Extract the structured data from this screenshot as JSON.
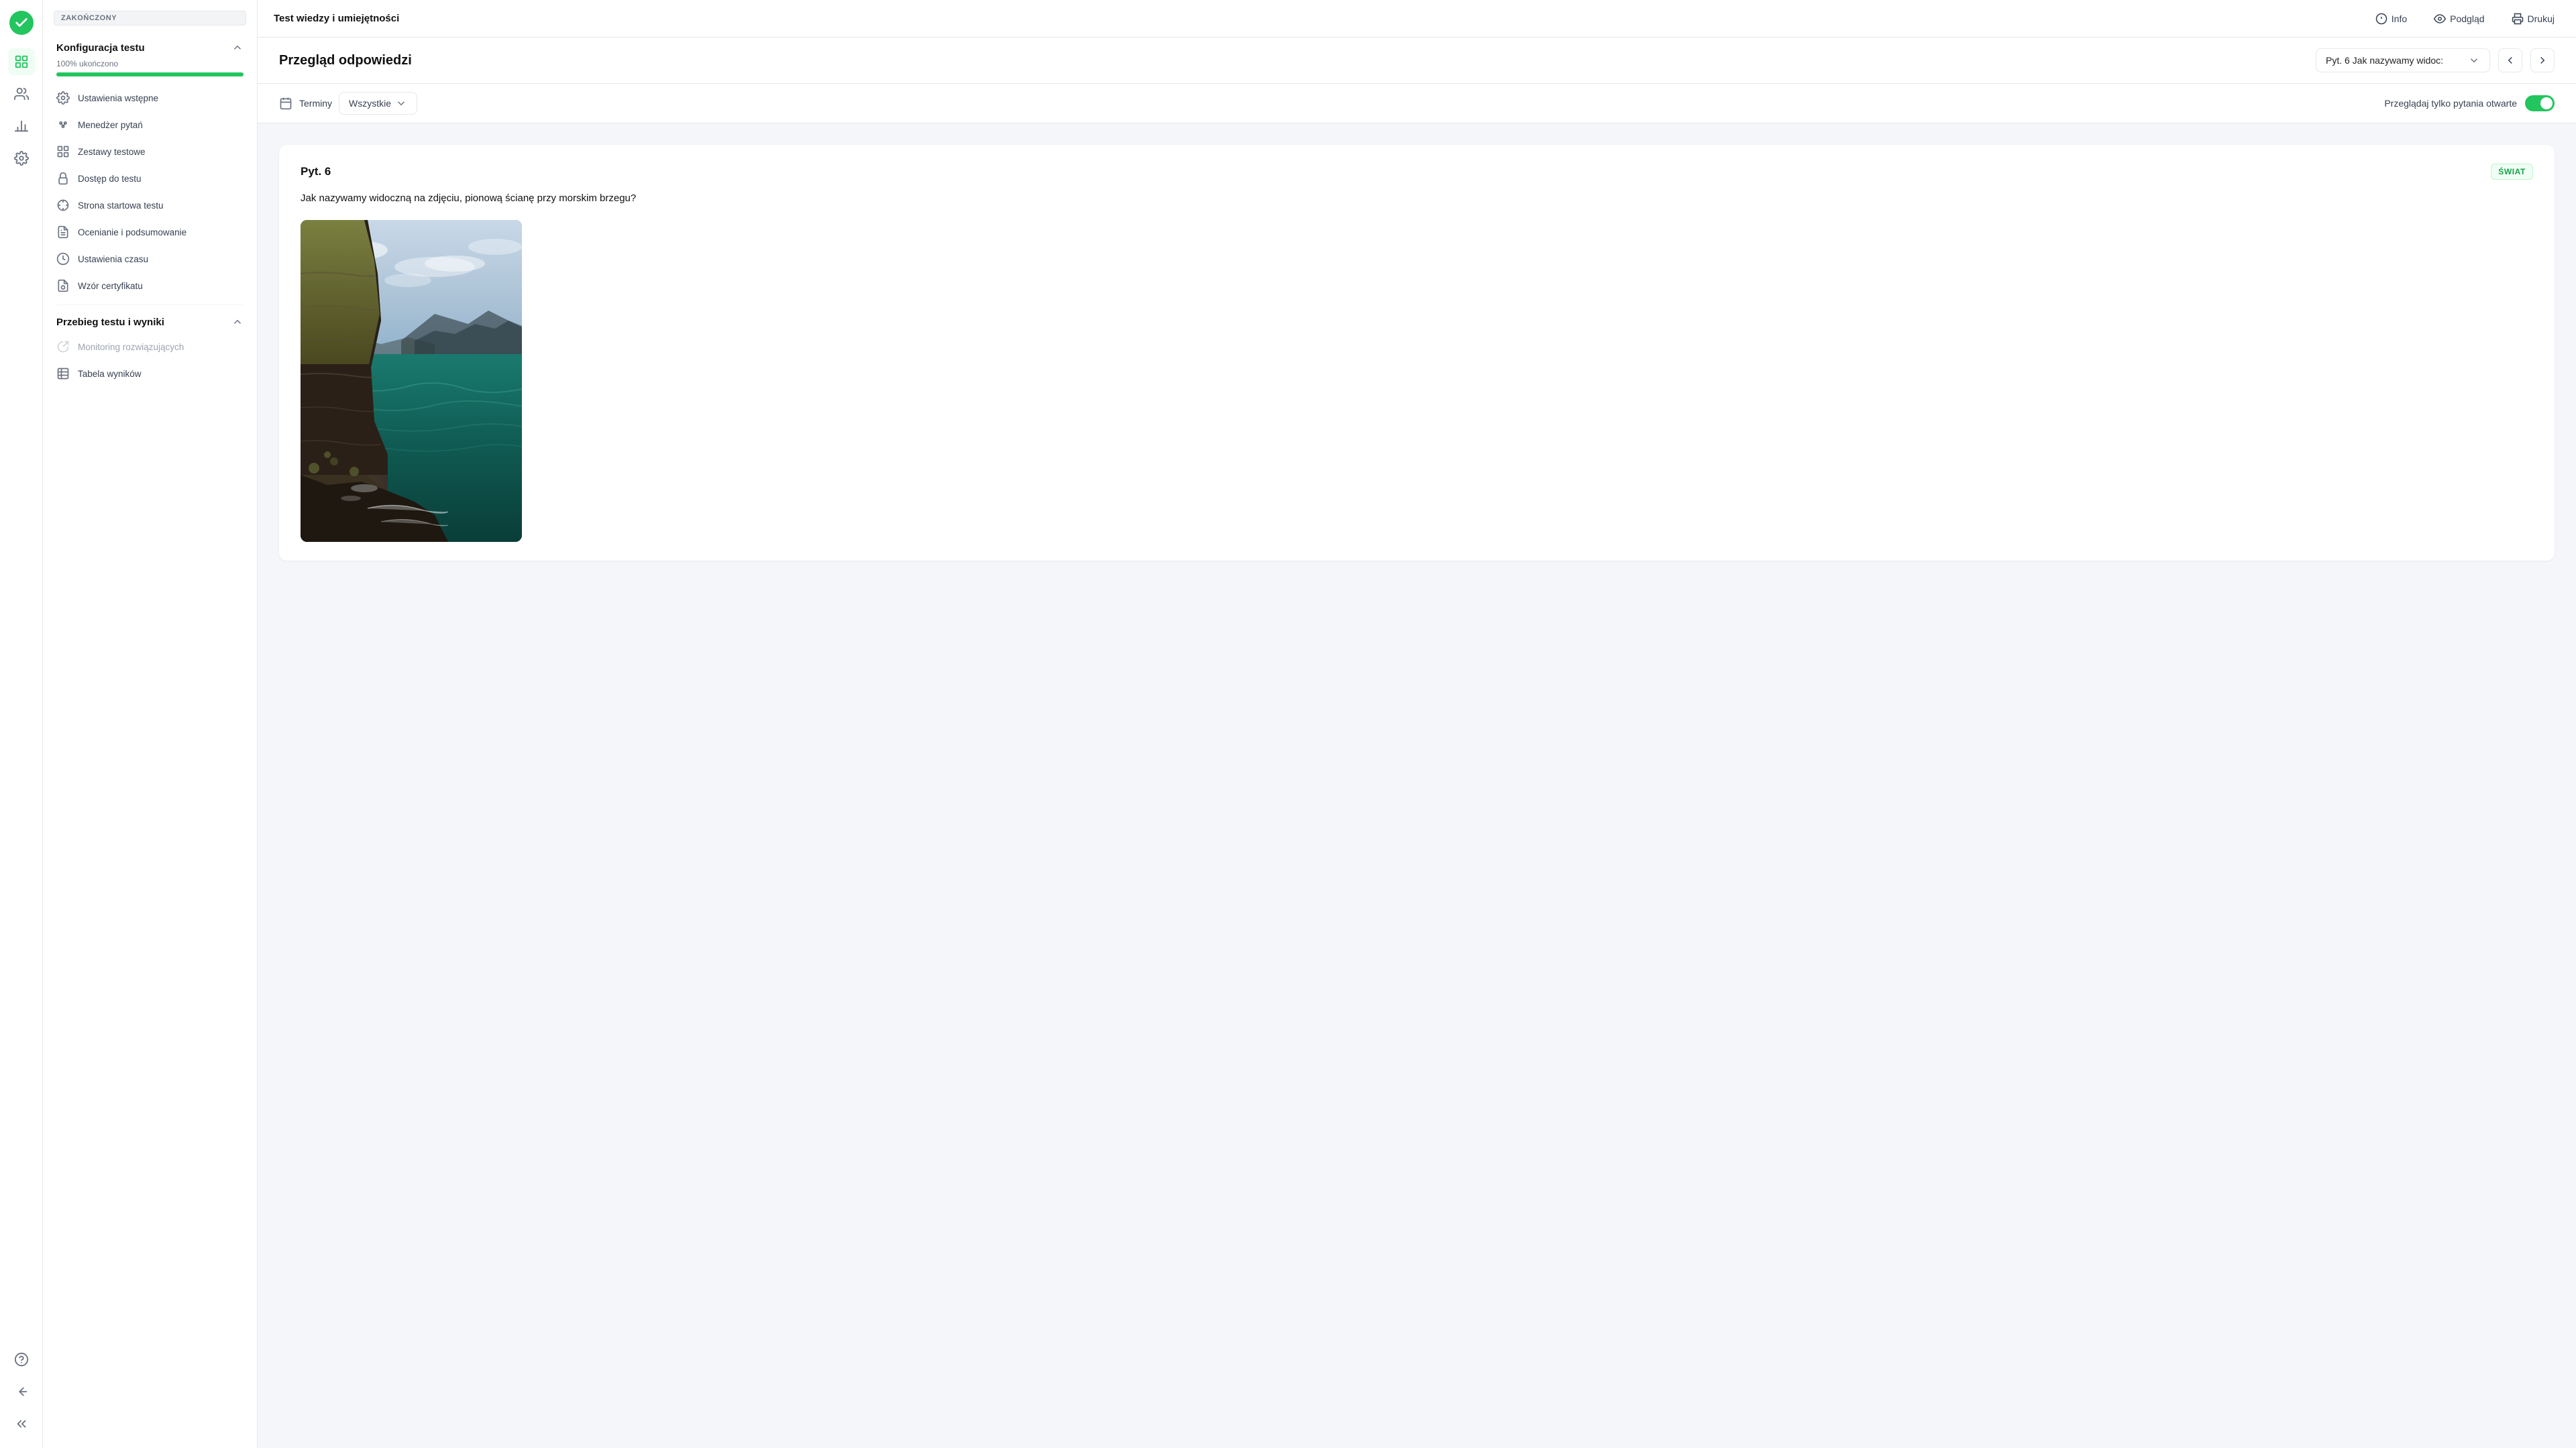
{
  "app": {
    "title": "Test wiedzy i umiejętności"
  },
  "topbar": {
    "info_label": "Info",
    "preview_label": "Podgląd",
    "print_label": "Drukuj"
  },
  "sidebar": {
    "status_badge": "ZAKOŃCZONY",
    "config_section_title": "Konfiguracja testu",
    "progress_label": "100% ukończono",
    "progress_value": 100,
    "config_items": [
      {
        "label": "Ustawienia wstępne",
        "icon": "settings-icon"
      },
      {
        "label": "Menedżer pytań",
        "icon": "questions-icon"
      },
      {
        "label": "Zestawy testowe",
        "icon": "sets-icon"
      },
      {
        "label": "Dostęp do testu",
        "icon": "lock-icon"
      },
      {
        "label": "Strona startowa testu",
        "icon": "start-page-icon"
      },
      {
        "label": "Ocenianie i podsumowanie",
        "icon": "grading-icon"
      },
      {
        "label": "Ustawienia czasu",
        "icon": "time-icon"
      },
      {
        "label": "Wzór certyfikatu",
        "icon": "certificate-icon"
      }
    ],
    "results_section_title": "Przebieg testu i wyniki",
    "results_items": [
      {
        "label": "Monitoring rozwiązujących",
        "icon": "monitoring-icon",
        "disabled": true
      },
      {
        "label": "Tabela wyników",
        "icon": "results-table-icon",
        "disabled": false
      }
    ]
  },
  "content_header": {
    "title": "Przegląd odpowiedzi",
    "question_selector_text": "Pyt. 6 Jak nazywamy widoc:",
    "prev_label": "prev",
    "next_label": "next"
  },
  "filter_bar": {
    "terms_label": "Terminy",
    "terms_value": "Wszystkie",
    "open_questions_label": "Przeglądaj tylko pytania otwarte",
    "toggle_active": true
  },
  "question": {
    "number": "Pyt. 6",
    "tag": "ŚWIAT",
    "text": "Jak nazywamy widoczną na zdjęciu, pionową ścianę przy morskim brzegu?",
    "image_alt": "Klif przy morskim brzegu"
  }
}
